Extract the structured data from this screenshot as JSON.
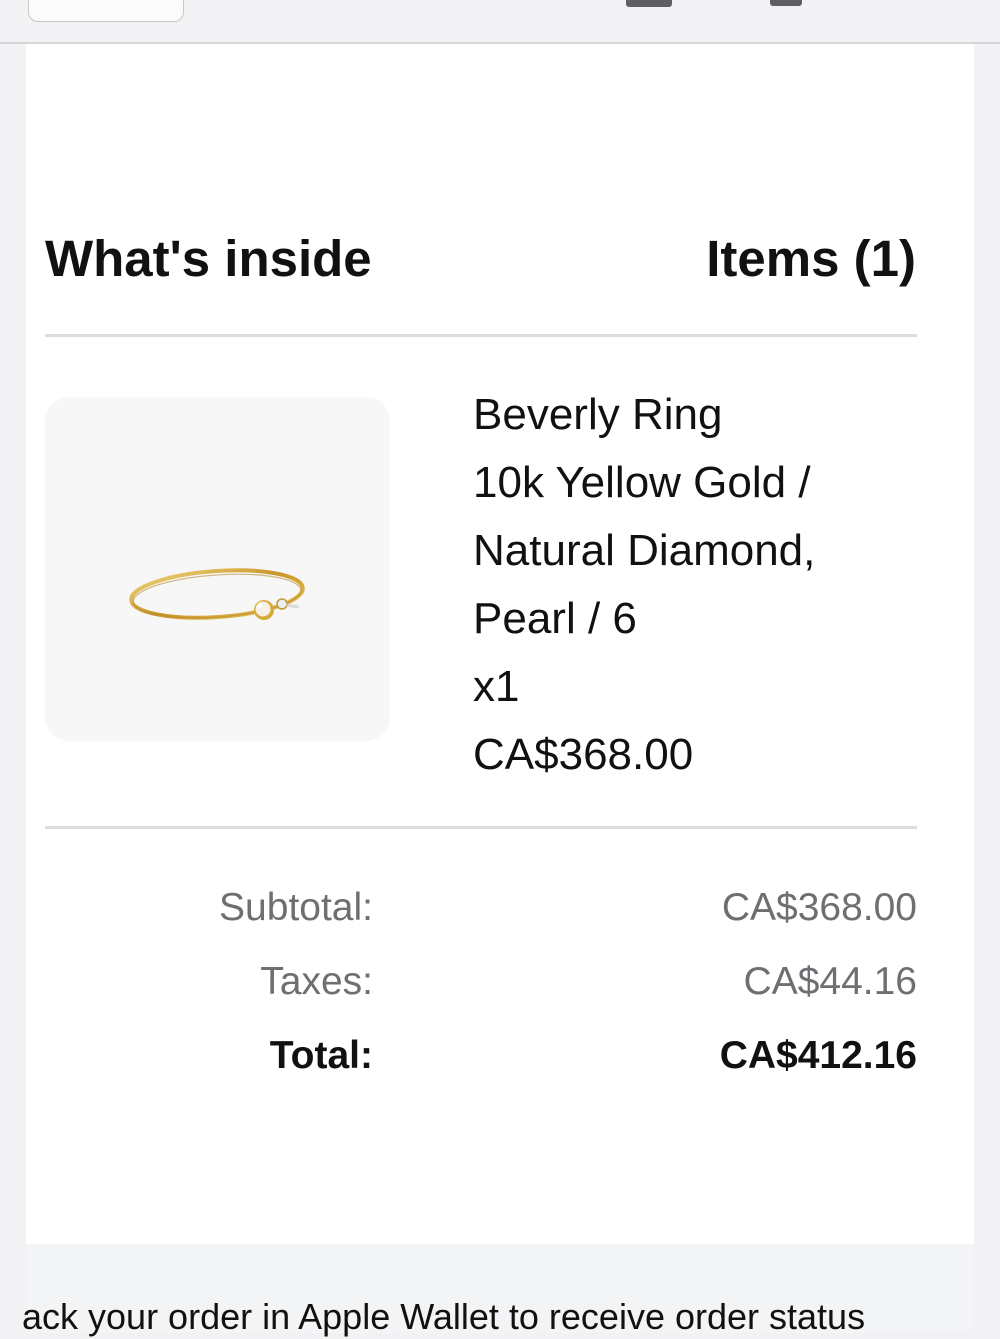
{
  "section": {
    "title": "What's inside",
    "items_count": "Items (1)"
  },
  "product": {
    "image_icon": "ring-image",
    "name": "Beverly Ring",
    "variant_lines": [
      "10k Yellow Gold /",
      "Natural Diamond,",
      "Pearl / 6"
    ],
    "quantity": "x1",
    "price": "CA$368.00"
  },
  "summary": {
    "subtotal_label": "Subtotal:",
    "subtotal_value": "CA$368.00",
    "taxes_label": "Taxes:",
    "taxes_value": "CA$44.16",
    "total_label": "Total:",
    "total_value": "CA$412.16"
  },
  "footer": {
    "text": "ack your order in Apple Wallet to receive order status"
  },
  "colors": {
    "background": "#f2f2f4",
    "card": "#ffffff",
    "muted_text": "#6f6f73",
    "gold": "#d4a93a"
  }
}
